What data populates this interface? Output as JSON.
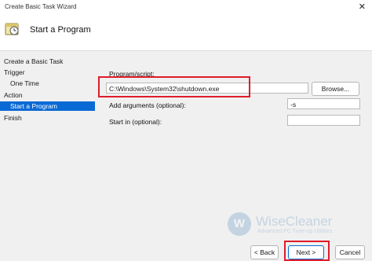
{
  "window": {
    "title": "Create Basic Task Wizard",
    "close_glyph": "✕"
  },
  "header": {
    "heading": "Start a Program",
    "icon": "task-clock-icon"
  },
  "sidebar": {
    "items": [
      {
        "label": "Create a Basic Task"
      },
      {
        "label": "Trigger"
      },
      {
        "label": "One Time"
      },
      {
        "label": "Action"
      },
      {
        "label": "Start a Program"
      },
      {
        "label": "Finish"
      }
    ]
  },
  "form": {
    "program_label": "Program/script:",
    "program_value": "C:\\Windows\\System32\\shutdown.exe",
    "browse_label": "Browse...",
    "args_label": "Add arguments (optional):",
    "args_value": "-s",
    "startin_label": "Start in (optional):",
    "startin_value": ""
  },
  "buttons": {
    "back": "< Back",
    "next": "Next >",
    "cancel": "Cancel"
  },
  "watermark": {
    "logo_letter": "W",
    "brand": "WiseCleaner",
    "tagline": "Advanced PC Tune-up Utilities"
  },
  "colors": {
    "selection": "#0a6ad5",
    "highlight_box": "#e01c2a"
  }
}
